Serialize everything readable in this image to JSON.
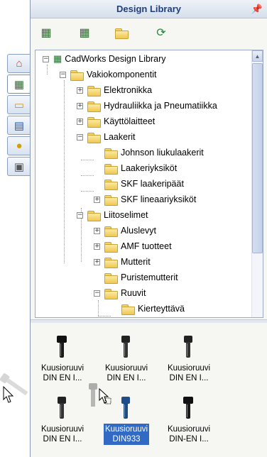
{
  "pane": {
    "title": "Design Library",
    "pin_icon": "pushpin-icon"
  },
  "toolbar": {
    "buttons": [
      {
        "icon": "add-to-library-icon",
        "label": "Add to Library"
      },
      {
        "icon": "add-file-location-icon",
        "label": "Add File Location"
      },
      {
        "icon": "create-new-folder-icon",
        "label": "Create New Folder"
      },
      {
        "icon": "refresh-icon",
        "label": "Refresh"
      }
    ]
  },
  "side_tabs": [
    {
      "icon": "home-icon"
    },
    {
      "icon": "design-library-icon",
      "active": true
    },
    {
      "icon": "file-explorer-icon"
    },
    {
      "icon": "view-palette-icon"
    },
    {
      "icon": "appearances-icon"
    },
    {
      "icon": "custom-properties-icon"
    }
  ],
  "tree": {
    "root": "CadWorks Design Library",
    "nodes": [
      {
        "label": "Vakiokomponentit",
        "level": 1,
        "state": "expanded"
      },
      {
        "label": "Elektronikka",
        "level": 2,
        "state": "collapsed"
      },
      {
        "label": "Hydrauliikka ja Pneumatiikka",
        "level": 2,
        "state": "collapsed"
      },
      {
        "label": "Käyttölaitteet",
        "level": 2,
        "state": "collapsed"
      },
      {
        "label": "Laakerit",
        "level": 2,
        "state": "expanded"
      },
      {
        "label": "Johnson liukulaakerit",
        "level": 3,
        "state": "leaf"
      },
      {
        "label": "Laakeriyksiköt",
        "level": 3,
        "state": "leaf"
      },
      {
        "label": "SKF laakeripäät",
        "level": 3,
        "state": "leaf"
      },
      {
        "label": "SKF lineaariyksiköt",
        "level": 3,
        "state": "collapsed"
      },
      {
        "label": "Liitoselimet",
        "level": 2,
        "state": "expanded"
      },
      {
        "label": "Aluslevyt",
        "level": 3,
        "state": "collapsed"
      },
      {
        "label": "AMF tuotteet",
        "level": 3,
        "state": "collapsed"
      },
      {
        "label": "Mutterit",
        "level": 3,
        "state": "collapsed"
      },
      {
        "label": "Puristemutterit",
        "level": 3,
        "state": "leaf"
      },
      {
        "label": "Ruuvit",
        "level": 3,
        "state": "expanded"
      },
      {
        "label": "Kierteyttävä",
        "level": 4,
        "state": "leaf"
      }
    ]
  },
  "parts": [
    {
      "line1": "Kuusioruuvi",
      "line2": "DIN EN I...",
      "style": "dark-icon"
    },
    {
      "line1": "Kuusioruuvi",
      "line2": "DIN EN I...",
      "style": "dark-icon"
    },
    {
      "line1": "Kuusioruuvi",
      "line2": "DIN EN I...",
      "style": "dark-icon"
    },
    {
      "line1": "Kuusioruuvi",
      "line2": "DIN EN I...",
      "style": "dark-icon"
    },
    {
      "line1": "Kuusioruuvi",
      "line2": "DIN933",
      "style": "blue-icon",
      "selected": true
    },
    {
      "line1": "Kuusioruuvi",
      "line2": "DIN-EN I...",
      "style": "dark-icon"
    }
  ]
}
